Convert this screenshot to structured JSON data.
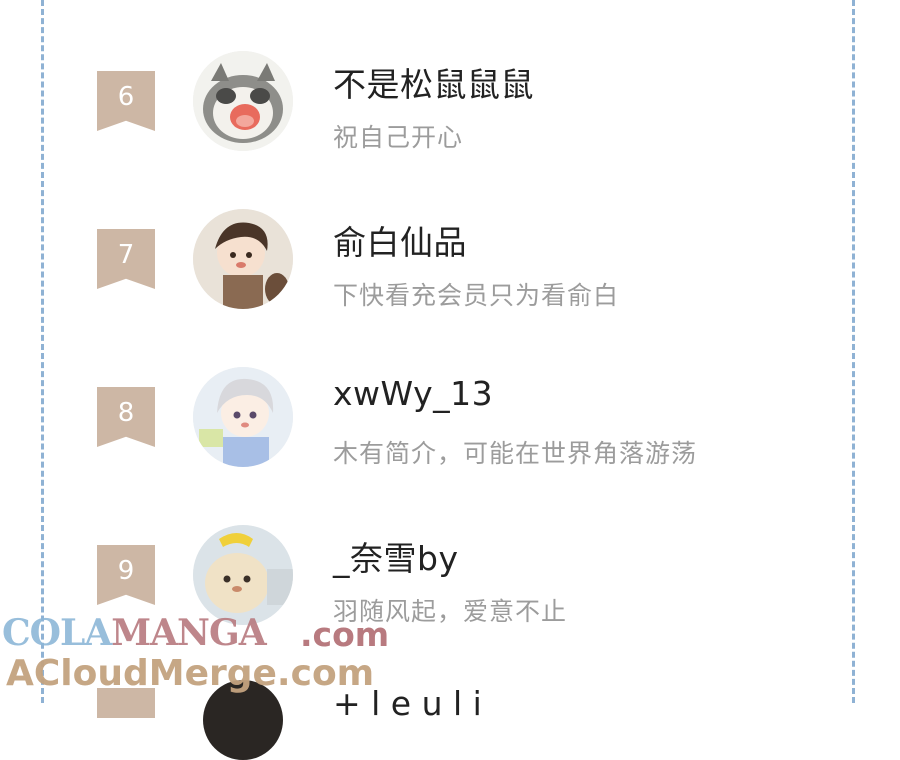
{
  "colors": {
    "rank_badge": "#cdb7a5",
    "dashed_border": "#8fb2d4",
    "name_text": "#222222",
    "bio_text": "#9c9c9c"
  },
  "users": [
    {
      "rank": "6",
      "name": "不是松鼠鼠鼠",
      "bio": "祝自己开心",
      "avatar_icon": "raccoon-avatar-icon"
    },
    {
      "rank": "7",
      "name": "俞白仙品",
      "bio": "下快看充会员只为看俞白",
      "avatar_icon": "anime-boy-avatar-icon"
    },
    {
      "rank": "8",
      "name": "xwWy_13",
      "bio": "木有简介，可能在世界角落游荡",
      "avatar_icon": "white-hair-avatar-icon"
    },
    {
      "rank": "9",
      "name": "_奈雪by",
      "bio": "羽随风起，爱意不止",
      "avatar_icon": "plush-toy-avatar-icon"
    }
  ],
  "partial_user": {
    "name": "+ l e u l i"
  },
  "watermark": {
    "line1_a": "COLA",
    "line1_b": "MANGA",
    "line1_c": ".com",
    "line2": "ACloudMerge.com"
  }
}
